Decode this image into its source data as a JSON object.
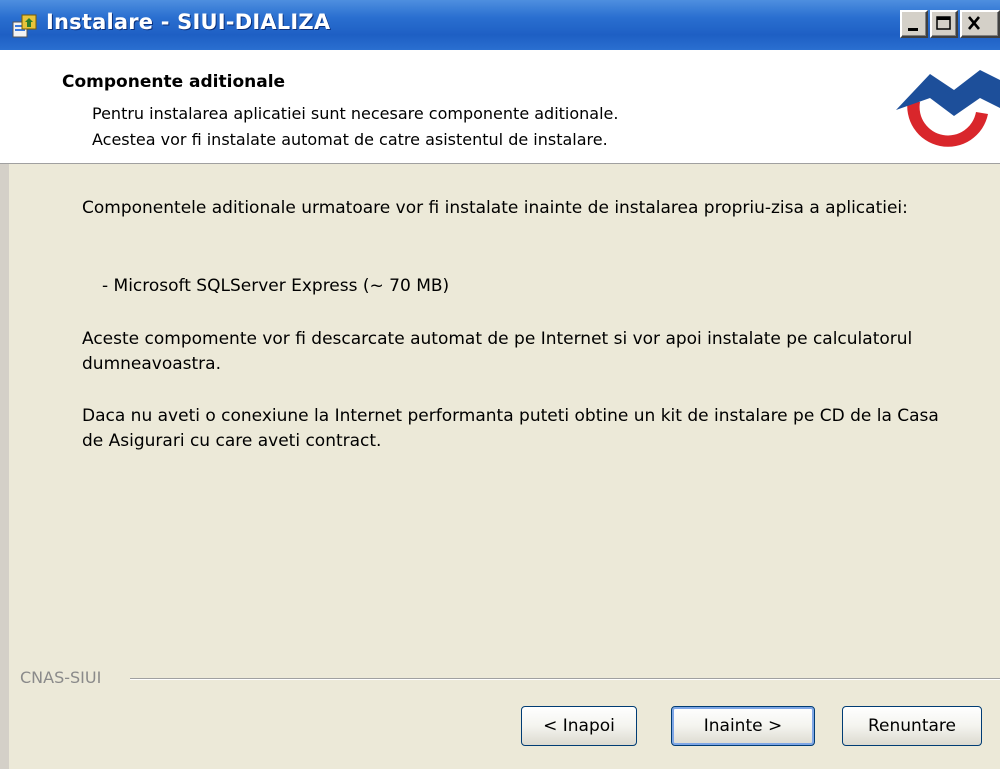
{
  "window": {
    "title": "Instalare - SIUI-DIALIZA"
  },
  "header": {
    "title": "Componente aditionale",
    "description_line1": "Pentru instalarea aplicatiei sunt necesare componente aditionale.",
    "description_line2": "Acestea vor fi instalate automat de catre asistentul de instalare."
  },
  "content": {
    "paragraph1": "Componentele aditionale urmatoare vor fi instalate inainte de instalarea propriu-zisa a aplicatiei:",
    "list_item": "- Microsoft SQLServer Express (~ 70 MB)",
    "paragraph2": "Aceste compomente vor fi descarcate automat de pe Internet si vor apoi instalate pe calculatorul dumneavoastra.",
    "paragraph3": "Daca nu aveti o conexiune la Internet performanta puteti obtine un kit de instalare pe CD de la Casa de Asigurari cu care aveti contract."
  },
  "footer": {
    "group_label": "CNAS-SIUI",
    "back_label": "< Inapoi",
    "next_label": "Inainte >",
    "cancel_label": "Renuntare"
  },
  "colors": {
    "titlebar": "#2a6fd0",
    "dialog_bg": "#ece9d8",
    "logo_red": "#d9262b",
    "logo_blue": "#1d4f9a"
  },
  "icons": [
    "app-installer-icon",
    "minimize-icon",
    "maximize-icon",
    "close-icon",
    "cnas-logo"
  ]
}
